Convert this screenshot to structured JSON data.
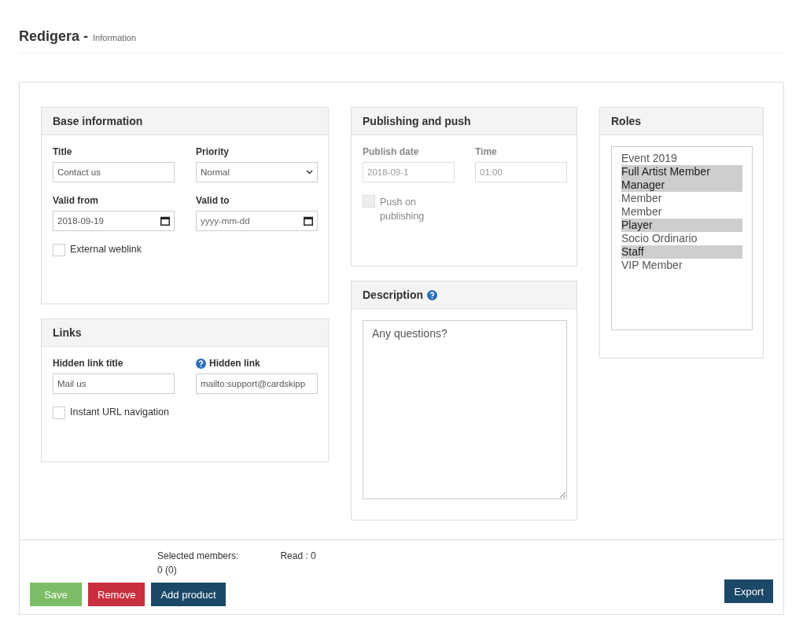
{
  "header": {
    "title": "Redigera -",
    "subtitle": "Information"
  },
  "base_information": {
    "title": "Base information",
    "fields": [
      {
        "label": "Title",
        "kind": "text",
        "value": "Contact us",
        "disabled": false
      },
      {
        "label": "Priority",
        "kind": "select",
        "value": "Normal",
        "disabled": false
      },
      {
        "label": "Valid from",
        "kind": "date",
        "value": "2018-09-19",
        "disabled": false
      },
      {
        "label": "Valid to",
        "kind": "date",
        "placeholder": "yyyy-mm-dd",
        "disabled": false
      }
    ],
    "checkbox": {
      "label": "External weblink",
      "checked": false,
      "disabled": false
    }
  },
  "links": {
    "title": "Links",
    "fields": [
      {
        "label": "Hidden link title",
        "kind": "text",
        "value": "Mail us",
        "disabled": false,
        "help": false
      },
      {
        "label": "Hidden link",
        "kind": "text",
        "value": "mailto:support@cardskipp",
        "disabled": false,
        "help": true
      }
    ],
    "checkbox": {
      "label": "Instant URL navigation",
      "checked": false,
      "disabled": false
    }
  },
  "publishing": {
    "title": "Publishing and push",
    "fields": [
      {
        "label": "Publish date",
        "kind": "text",
        "value": "2018-09-1",
        "disabled": true
      },
      {
        "label": "Time",
        "kind": "text",
        "value": "01:00",
        "disabled": true
      }
    ],
    "checkbox": {
      "label": "Push on publishing",
      "checked": false,
      "disabled": true
    }
  },
  "description": {
    "title": "Description",
    "help": true,
    "value": "Any questions?"
  },
  "roles": {
    "title": "Roles",
    "items": [
      {
        "label": "Event 2019",
        "selected": false
      },
      {
        "label": "Full Artist Member Manager",
        "selected": true
      },
      {
        "label": "Member",
        "selected": false
      },
      {
        "label": "Member",
        "selected": false
      },
      {
        "label": "Player",
        "selected": true
      },
      {
        "label": "Socio Ordinario",
        "selected": false
      },
      {
        "label": "Staff",
        "selected": true
      },
      {
        "label": "VIP Member",
        "selected": false
      }
    ]
  },
  "footer": {
    "selected_members_label": "Selected members:",
    "selected_members_value": "0 (0)",
    "read": "Read : 0",
    "buttons": [
      {
        "label": "Save",
        "kind": "success"
      },
      {
        "label": "Remove",
        "kind": "danger"
      },
      {
        "label": "Add product",
        "kind": "primary"
      }
    ],
    "export_button": {
      "label": "Export",
      "kind": "primary"
    }
  }
}
